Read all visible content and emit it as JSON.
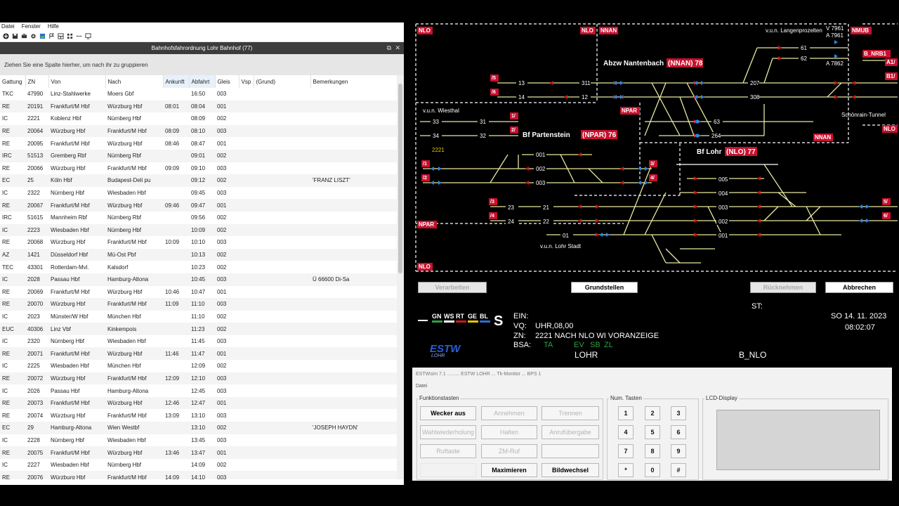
{
  "left_window": {
    "menu": [
      "Datei",
      "Fenster",
      "Hilfe"
    ],
    "title": "Bahnhofsfahrordnung Lohr Bahnhof (77)",
    "group_hint": "Ziehen Sie eine Spalte hierher, um nach ihr zu gruppieren",
    "columns": [
      "Gattung",
      "ZN",
      "Von",
      "Nach",
      "Ankunft",
      "Abfahrt",
      "Gleis",
      "Vsp",
      "(Grund)",
      "Bemerkungen"
    ],
    "rows": [
      [
        "TKC",
        "47990",
        "Linz-Stahlwerke",
        "Moers Gbf",
        "",
        "16:50",
        "003",
        "",
        "",
        ""
      ],
      [
        "RE",
        "20191",
        "Frankfurt/M Hbf",
        "Würzburg Hbf",
        "08:01",
        "08:04",
        "001",
        "",
        "",
        ""
      ],
      [
        "IC",
        "2221",
        "Koblenz Hbf",
        "Nürnberg Hbf",
        "",
        "08:09",
        "002",
        "",
        "",
        ""
      ],
      [
        "RE",
        "20064",
        "Würzburg Hbf",
        "Frankfurt/M Hbf",
        "08:09",
        "08:10",
        "003",
        "",
        "",
        ""
      ],
      [
        "RE",
        "20095",
        "Frankfurt/M Hbf",
        "Würzburg Hbf",
        "08:46",
        "08:47",
        "001",
        "",
        "",
        ""
      ],
      [
        "IRC",
        "51513",
        "Gremberg Rbf",
        "Nürnberg Rbf",
        "",
        "09:01",
        "002",
        "",
        "",
        ""
      ],
      [
        "RE",
        "20066",
        "Würzburg Hbf",
        "Frankfurt/M Hbf",
        "09:09",
        "09:10",
        "003",
        "",
        "",
        ""
      ],
      [
        "EC",
        "25",
        "Köln Hbf",
        "Budapest-Deli pu",
        "",
        "09:12",
        "002",
        "",
        "",
        "'FRANZ LISZT'"
      ],
      [
        "IC",
        "2322",
        "Nürnberg Hbf",
        "Wiesbaden Hbf",
        "",
        "09:45",
        "003",
        "",
        "",
        ""
      ],
      [
        "RE",
        "20067",
        "Frankfurt/M Hbf",
        "Würzburg Hbf",
        "09:46",
        "09:47",
        "001",
        "",
        "",
        ""
      ],
      [
        "IRC",
        "51615",
        "Mannheim Rbf",
        "Nürnberg Rbf",
        "",
        "09:56",
        "002",
        "",
        "",
        ""
      ],
      [
        "IC",
        "2223",
        "Wiesbaden Hbf",
        "Nürnberg Hbf",
        "",
        "10:09",
        "002",
        "",
        "",
        ""
      ],
      [
        "RE",
        "20068",
        "Würzburg Hbf",
        "Frankfurt/M Hbf",
        "10:09",
        "10:10",
        "003",
        "",
        "",
        ""
      ],
      [
        "AZ",
        "1421",
        "Düsseldorf Hbf",
        "Mü-Ost Pbf",
        "",
        "10:13",
        "002",
        "",
        "",
        ""
      ],
      [
        "TEC",
        "43301",
        "Rotterdam-Mvl.",
        "Kalsdorf",
        "",
        "10:23",
        "002",
        "",
        "",
        ""
      ],
      [
        "IC",
        "2028",
        "Passau Hbf",
        "Hamburg-Altona",
        "",
        "10:45",
        "003",
        "",
        "",
        "Ü 66600 Di-Sa"
      ],
      [
        "RE",
        "20069",
        "Frankfurt/M Hbf",
        "Würzburg Hbf",
        "10:46",
        "10:47",
        "001",
        "",
        "",
        ""
      ],
      [
        "RE",
        "20070",
        "Würzburg Hbf",
        "Frankfurt/M Hbf",
        "11:09",
        "11:10",
        "003",
        "",
        "",
        ""
      ],
      [
        "IC",
        "2023",
        "Münster/W Hbf",
        "München Hbf",
        "",
        "11:10",
        "002",
        "",
        "",
        ""
      ],
      [
        "EUC",
        "40306",
        "Linz Vbf",
        "Kinkempois",
        "",
        "11:23",
        "002",
        "",
        "",
        ""
      ],
      [
        "IC",
        "2320",
        "Nürnberg Hbf",
        "Wiesbaden Hbf",
        "",
        "11:45",
        "003",
        "",
        "",
        ""
      ],
      [
        "RE",
        "20071",
        "Frankfurt/M Hbf",
        "Würzburg Hbf",
        "11:46",
        "11:47",
        "001",
        "",
        "",
        ""
      ],
      [
        "IC",
        "2225",
        "Wiesbaden Hbf",
        "München Hbf",
        "",
        "12:09",
        "002",
        "",
        "",
        ""
      ],
      [
        "RE",
        "20072",
        "Würzburg Hbf",
        "Frankfurt/M Hbf",
        "12:09",
        "12:10",
        "003",
        "",
        "",
        ""
      ],
      [
        "IC",
        "2026",
        "Passau Hbf",
        "Hamburg-Altona",
        "",
        "12:45",
        "003",
        "",
        "",
        ""
      ],
      [
        "RE",
        "20073",
        "Frankfurt/M Hbf",
        "Würzburg Hbf",
        "12:46",
        "12:47",
        "001",
        "",
        "",
        ""
      ],
      [
        "RE",
        "20074",
        "Würzburg Hbf",
        "Frankfurt/M Hbf",
        "13:09",
        "13:10",
        "003",
        "",
        "",
        ""
      ],
      [
        "EC",
        "29",
        "Hamburg-Altona",
        "Wien Westbf",
        "",
        "13:10",
        "002",
        "",
        "",
        "'JOSEPH HAYDN'"
      ],
      [
        "IC",
        "2228",
        "Nürnberg Hbf",
        "Wiesbaden Hbf",
        "",
        "13:45",
        "003",
        "",
        "",
        ""
      ],
      [
        "RE",
        "20075",
        "Frankfurt/M Hbf",
        "Würzburg Hbf",
        "13:46",
        "13:47",
        "001",
        "",
        "",
        ""
      ],
      [
        "IC",
        "2227",
        "Wiesbaden Hbf",
        "Nürnberg Hbf",
        "",
        "14:09",
        "002",
        "",
        "",
        ""
      ],
      [
        "RE",
        "20076",
        "Würzburg Hbf",
        "Frankfurt/M Hbf",
        "14:09",
        "14:10",
        "003",
        "",
        "",
        ""
      ]
    ]
  },
  "track": {
    "labels": {
      "nlo1": "NLO",
      "nlo2": "NLO",
      "nnan1": "NNAN",
      "nmub": "NMUB",
      "b_nrb1": "B_NRB1",
      "a1": "A1/",
      "b1": "B1/",
      "npar1": "NPAR",
      "nlo3": "NLO",
      "nnan2": "NNAN",
      "npar2": "NPAR",
      "nlo4": "NLO"
    },
    "stations": {
      "nantenbach": "Abzw Nantenbach",
      "nantenbach_code": "(NNAN) 78",
      "partenstein": "Bf Partenstein",
      "partenstein_code": "(NPAR) 76",
      "lohr": "Bf Lohr",
      "lohr_code": "(NLO) 77"
    },
    "texts": {
      "langenprozelten": "v.u.n. Langenprozelten",
      "v7961": "V 7961",
      "a7961": "A 7961",
      "a7862": "A 7862",
      "schoenrain": "Schönrain-Tunnel",
      "wiesthal": "v.u.n. Wiesthal",
      "lohr_stadt": "v.u.n. Lohr Stadt",
      "zug2221": "2221"
    },
    "numbers": [
      "13",
      "14",
      "311",
      "12",
      "207",
      "308",
      "61",
      "62",
      "63",
      "264",
      "33",
      "31",
      "34",
      "32",
      "001",
      "002",
      "003",
      "005",
      "004",
      "003",
      "002",
      "001",
      "23",
      "21",
      "24",
      "22",
      "01"
    ],
    "tracknums": [
      "/5",
      "/6",
      "1/",
      "2/",
      "/1",
      "/2",
      "3/",
      "4/",
      "/3",
      "/4",
      "5/",
      "6/"
    ]
  },
  "buttons": {
    "verarbeiten": "Verarbeiten",
    "grundstellen": "Grundstellen",
    "ruecknehmen": "Rücknehmen",
    "abbrechen": "Abbrechen"
  },
  "status": {
    "legend": [
      "GN",
      "WS",
      "RT",
      "GE",
      "BL"
    ],
    "s_letter": "S",
    "ein_label": "EIN:",
    "vq_label": "VQ:",
    "vq_value": "UHR,08,00",
    "zn_label": "ZN:",
    "zn_value": "2221 NACH NLO WI VORANZEIGE",
    "bsa_label": "BSA:",
    "bsa_ta": "TA",
    "bsa_ev": "EV",
    "bsa_sb": "SB",
    "bsa_zl": "ZL",
    "lohr": "LOHR",
    "b_nlo": "B_NLO",
    "st_label": "ST:",
    "date": "SO  14. 11. 2023",
    "time": "08:02:07",
    "logo": "ESTW",
    "logo_sub": "LOHR"
  },
  "tk": {
    "title": "ESTWsim 7.1 ......... ESTW LOHR ... Tk-Monitor ... BPS 1",
    "menu": "Datei",
    "funktionstasten": "Funktionstasten",
    "num_tasten": "Num. Tasten",
    "lcd": "LCD-Display",
    "keys": [
      "Wecker aus",
      "Annehmen",
      "Trennen",
      "Wahlwiederholung",
      "Halten",
      "Anrufübergabe",
      "Ruftaste",
      "ZM-Ruf",
      "",
      "",
      "Maximieren",
      "Bildwechsel"
    ],
    "numkeys": [
      "1",
      "2",
      "3",
      "4",
      "5",
      "6",
      "7",
      "8",
      "9",
      "*",
      "0",
      "#"
    ]
  },
  "colors": {
    "track": "#e8e8a0",
    "signal_red": "#cc1a1a",
    "signal_blue": "#2e86de",
    "label_red": "#c8102e"
  }
}
